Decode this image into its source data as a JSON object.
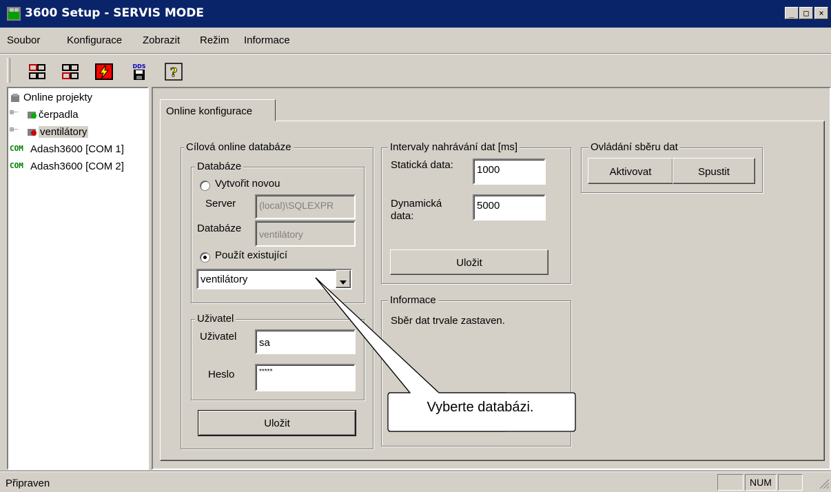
{
  "window": {
    "title": "3600 Setup - SERVIS MODE",
    "minimize": "_",
    "maximize": "□",
    "close": "×"
  },
  "menu": [
    "Soubor",
    "Konfigurace",
    "Zobrazit",
    "Režim",
    "Informace"
  ],
  "toolbar": [
    "connect-icon",
    "refresh-icon",
    "flash-icon",
    "dds-save-icon",
    "help-icon"
  ],
  "toolbar_dds_label": "DDS",
  "tree": {
    "root": "Online projekty",
    "children": [
      "čerpadla",
      "ventilátory"
    ],
    "com": [
      "Adash3600 [COM 1]",
      "Adash3600 [COM 2]"
    ],
    "com_icon_text": "COM"
  },
  "tab": {
    "label": "Online konfigurace"
  },
  "target_db": {
    "group_label": "Cílová online databáze",
    "database": {
      "group_label": "Databáze",
      "create_new": "Vytvořit novou",
      "server_label": "Server",
      "server_value": "(local)\\SQLEXPR",
      "db_label": "Databáze",
      "db_value": "ventilátory",
      "use_existing": "Použít existující",
      "selected": "ventilátory"
    },
    "user": {
      "group_label": "Uživatel",
      "user_label": "Uživatel",
      "user_value": "sa",
      "password_label": "Heslo",
      "password_value": "*****"
    },
    "save": "Uložit"
  },
  "intervals": {
    "group_label": "Intervaly nahrávání dat [ms]",
    "static_label": "Statická data:",
    "static_value": "1000",
    "dynamic_label_1": "Dynamická",
    "dynamic_label_2": "data:",
    "dynamic_value": "5000",
    "save": "Uložit"
  },
  "info": {
    "group_label": "Informace",
    "text": "Sběr dat trvale zastaven."
  },
  "control": {
    "group_label": "Ovládání sběru dat",
    "activate": "Aktivovat",
    "start": "Spustit"
  },
  "callout": {
    "text": "Vyberte databázi."
  },
  "status": {
    "text": "Připraven",
    "num": "NUM"
  },
  "colors": {
    "titlebar": "#0a246a",
    "face": "#d4d0c8"
  }
}
